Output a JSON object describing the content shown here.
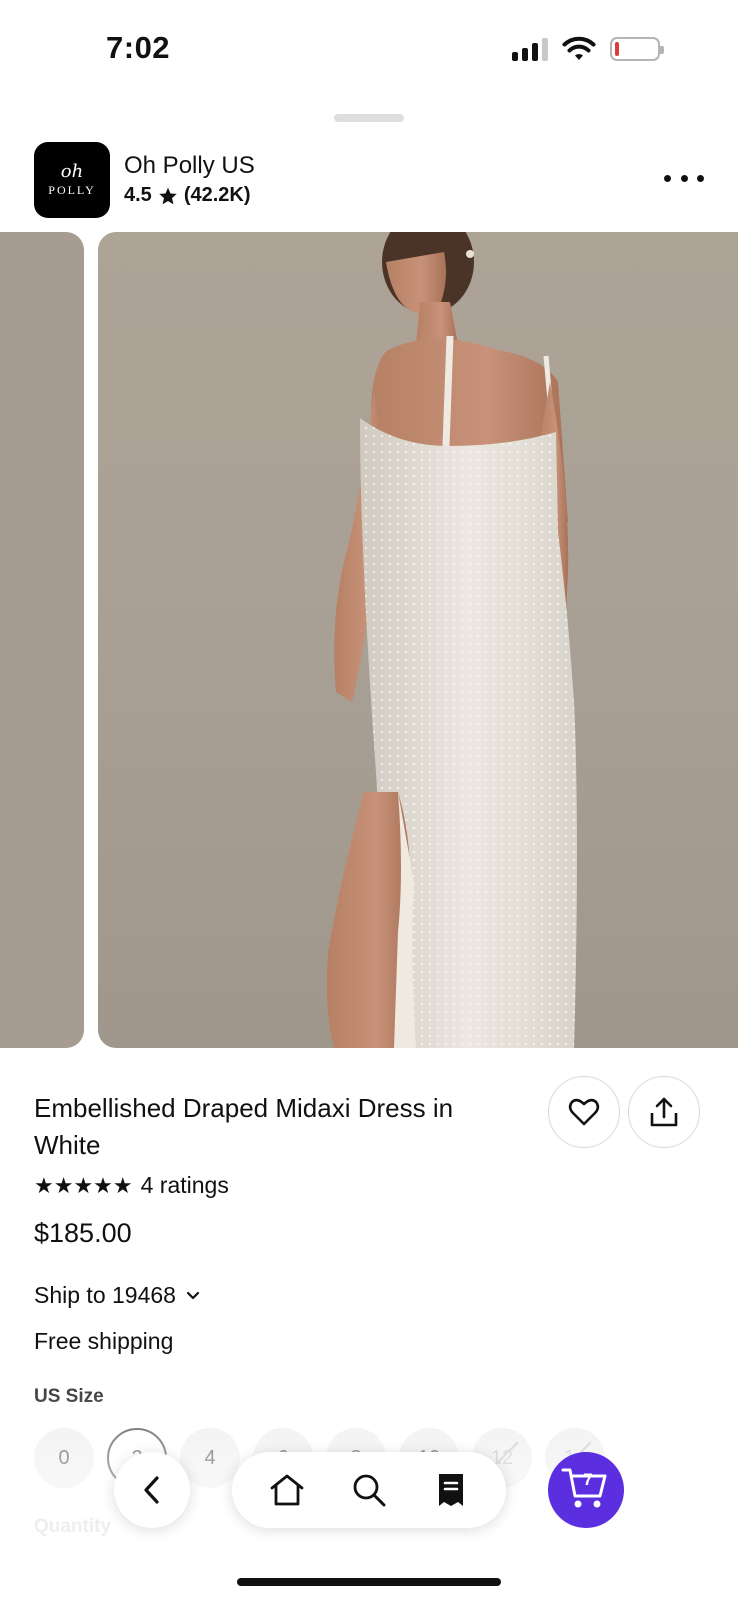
{
  "status_bar": {
    "time": "7:02",
    "icons": [
      "cellular-signal-icon",
      "wifi-icon",
      "battery-low-icon"
    ],
    "battery_color": "#e03a3a"
  },
  "shop": {
    "logo_script": "oh",
    "logo_caps": "POLLY",
    "name": "Oh Polly US",
    "rating": "4.5",
    "rating_count": "(42.2K)"
  },
  "gallery": {
    "background_color": "#aaa195"
  },
  "product": {
    "title": "Embellished Draped Midaxi Dress in White",
    "stars": "★★★★★",
    "ratings_text": "4 ratings",
    "price": "$185.00",
    "ship_to": "Ship to 19468",
    "shipping": "Free shipping",
    "size_label": "US Size",
    "sizes": [
      {
        "label": "0",
        "state": "available"
      },
      {
        "label": "2",
        "state": "selected"
      },
      {
        "label": "4",
        "state": "available"
      },
      {
        "label": "6",
        "state": "available"
      },
      {
        "label": "8",
        "state": "available"
      },
      {
        "label": "10",
        "state": "available"
      },
      {
        "label": "12",
        "state": "unavailable"
      },
      {
        "label": "14",
        "state": "unavailable"
      }
    ],
    "quantity_label": "Quantity"
  },
  "bottom_nav": {
    "items": [
      "back-icon",
      "home-icon",
      "search-icon",
      "receipt-icon"
    ],
    "cart_count": "7",
    "cart_color": "#5b2ee0"
  }
}
